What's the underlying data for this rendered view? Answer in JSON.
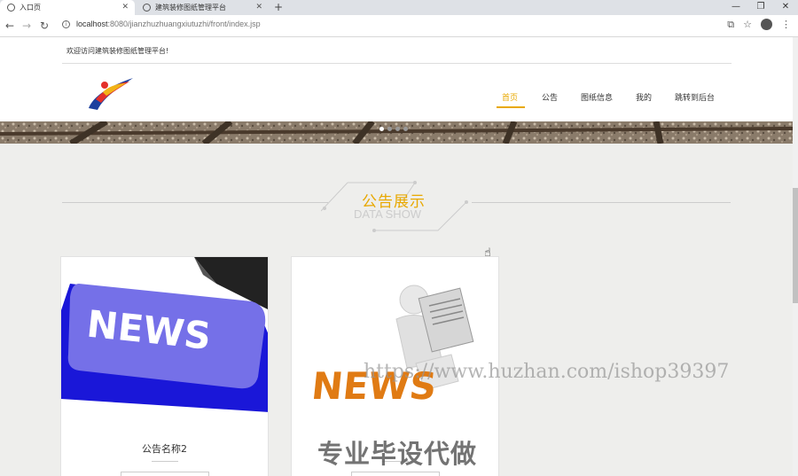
{
  "browser": {
    "tabs": [
      {
        "title": "入口页",
        "active": true
      },
      {
        "title": "建筑装修图纸管理平台",
        "active": false
      }
    ],
    "url_host": "localhost",
    "url_path": ":8080/jianzhuzhuangxiutuzhi/front/index.jsp"
  },
  "header": {
    "welcome": "欢迎访问建筑装修图纸管理平台!",
    "nav": [
      "首页",
      "公告",
      "图纸信息",
      "我的",
      "跳转到后台"
    ]
  },
  "section": {
    "title": "公告展示",
    "subtitle": "DATA SHOW"
  },
  "cards": [
    {
      "name": "公告名称2",
      "image_text": "NEWS"
    },
    {
      "name": "",
      "image_text": "NEWS"
    }
  ],
  "overlay": {
    "watermark": "https://www.huzhan.com/ishop39397",
    "slogan": "专业毕设代做"
  },
  "colors": {
    "accent": "#e8a800"
  }
}
